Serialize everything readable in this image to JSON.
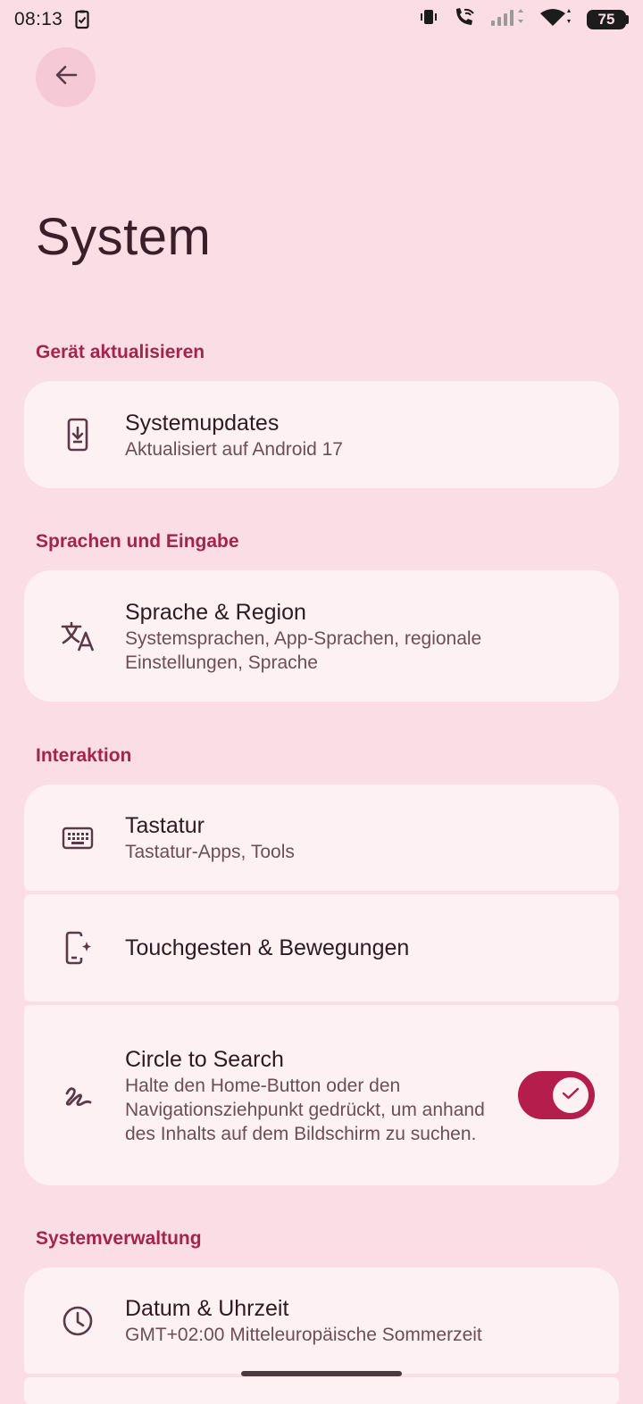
{
  "status_bar": {
    "time": "08:13",
    "battery": "75"
  },
  "header": {
    "back_icon": "arrow-left-icon",
    "title": "System"
  },
  "sections": {
    "update": {
      "header": "Gerät aktualisieren",
      "items": [
        {
          "icon": "system-update-icon",
          "title": "Systemupdates",
          "subtitle": "Aktualisiert auf Android 17"
        }
      ]
    },
    "languages": {
      "header": "Sprachen und Eingabe",
      "items": [
        {
          "icon": "translate-icon",
          "title": "Sprache & Region",
          "subtitle": "Systemsprachen, App-Sprachen, regionale Einstellungen, Sprache"
        }
      ]
    },
    "interaction": {
      "header": "Interaktion",
      "items": [
        {
          "icon": "keyboard-icon",
          "title": "Tastatur",
          "subtitle": "Tastatur-Apps, Tools"
        },
        {
          "icon": "gestures-icon",
          "title": "Touchgesten & Bewegungen",
          "subtitle": ""
        },
        {
          "icon": "circle-to-search-icon",
          "title": "Circle to Search",
          "subtitle": "Halte den Home-Button oder den Navigationsziehpunkt gedrückt, um anhand des Inhalts auf dem Bildschirm zu suchen.",
          "toggle_on": true
        }
      ]
    },
    "management": {
      "header": "Systemverwaltung",
      "items": [
        {
          "icon": "clock-icon",
          "title": "Datum & Uhrzeit",
          "subtitle": "GMT+02:00 Mitteleuropäische Sommerzeit"
        }
      ]
    }
  },
  "colors": {
    "background": "#fbdde6",
    "card": "#fdf1f4",
    "accent": "#b51d4d",
    "section_header": "#a3244c"
  }
}
